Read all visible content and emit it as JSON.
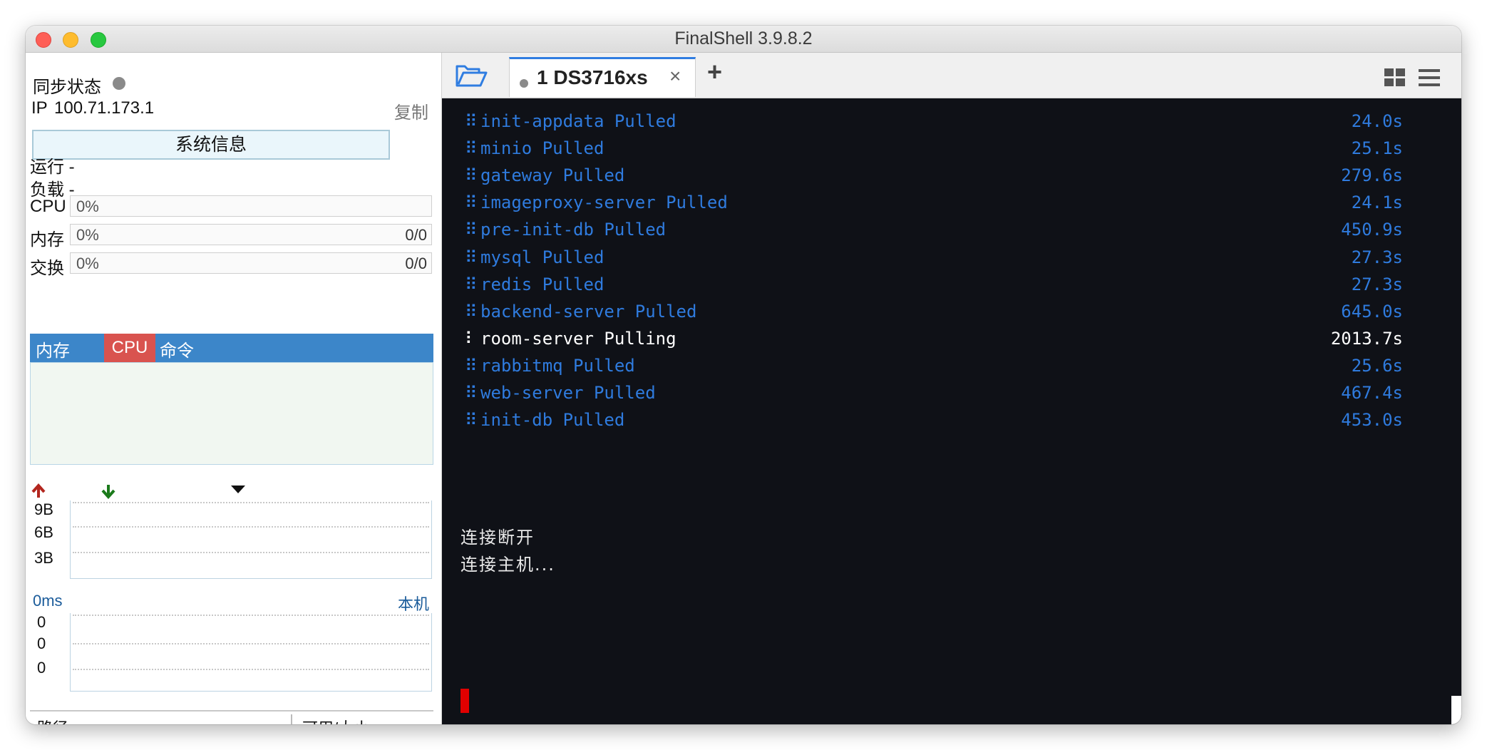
{
  "window": {
    "title": "FinalShell 3.9.8.2"
  },
  "left": {
    "sync_label": "同步状态",
    "ip_label": "IP",
    "ip_value": "100.71.173.1",
    "copy_label": "复制",
    "sysinfo_label": "系统信息",
    "run_label": "运行 -",
    "load_label": "负载 -",
    "cpu_label": "CPU",
    "cpu_pct": "0%",
    "mem_label": "内存",
    "mem_pct": "0%",
    "mem_ratio": "0/0",
    "swap_label": "交换",
    "swap_pct": "0%",
    "swap_ratio": "0/0",
    "proc_cols": [
      "内存",
      "CPU",
      "命令"
    ],
    "net_ticks": [
      "9B",
      "6B",
      "3B"
    ],
    "ping_label": "0ms",
    "host_label": "本机",
    "ping_ticks": [
      "0",
      "0",
      "0"
    ],
    "fs_cols": [
      "路径",
      "可用/大小"
    ]
  },
  "tabs": [
    {
      "label": "1 DS3716xs",
      "close": "×"
    }
  ],
  "add_tab": "+",
  "terminal": {
    "lines": [
      {
        "symbol": "⠿",
        "name": "init-appdata Pulled",
        "time": "24.0s",
        "state": "pulled"
      },
      {
        "symbol": "⠿",
        "name": "minio Pulled",
        "time": "25.1s",
        "state": "pulled"
      },
      {
        "symbol": "⠿",
        "name": "gateway Pulled",
        "time": "279.6s",
        "state": "pulled"
      },
      {
        "symbol": "⠿",
        "name": "imageproxy-server Pulled",
        "time": "24.1s",
        "state": "pulled"
      },
      {
        "symbol": "⠿",
        "name": "pre-init-db Pulled",
        "time": "450.9s",
        "state": "pulled"
      },
      {
        "symbol": "⠿",
        "name": "mysql Pulled",
        "time": "27.3s",
        "state": "pulled"
      },
      {
        "symbol": "⠿",
        "name": "redis Pulled",
        "time": "27.3s",
        "state": "pulled"
      },
      {
        "symbol": "⠿",
        "name": "backend-server Pulled",
        "time": "645.0s",
        "state": "pulled"
      },
      {
        "symbol": "⠇",
        "name": "room-server Pulling",
        "time": "2013.7s",
        "state": "pulling"
      },
      {
        "symbol": "⠿",
        "name": "rabbitmq Pulled",
        "time": "25.6s",
        "state": "pulled"
      },
      {
        "symbol": "⠿",
        "name": "web-server Pulled",
        "time": "467.4s",
        "state": "pulled"
      },
      {
        "symbol": "⠿",
        "name": "init-db Pulled",
        "time": "453.0s",
        "state": "pulled"
      }
    ],
    "disconnect_msg": "连接断开",
    "connecting_msg": "连接主机..."
  },
  "colors": {
    "accent": "#3c86c9",
    "cpu_badge": "#d9534f",
    "pulled": "#2f7bde",
    "cursor": "#e00000",
    "terminal_bg": "#0f1117"
  }
}
